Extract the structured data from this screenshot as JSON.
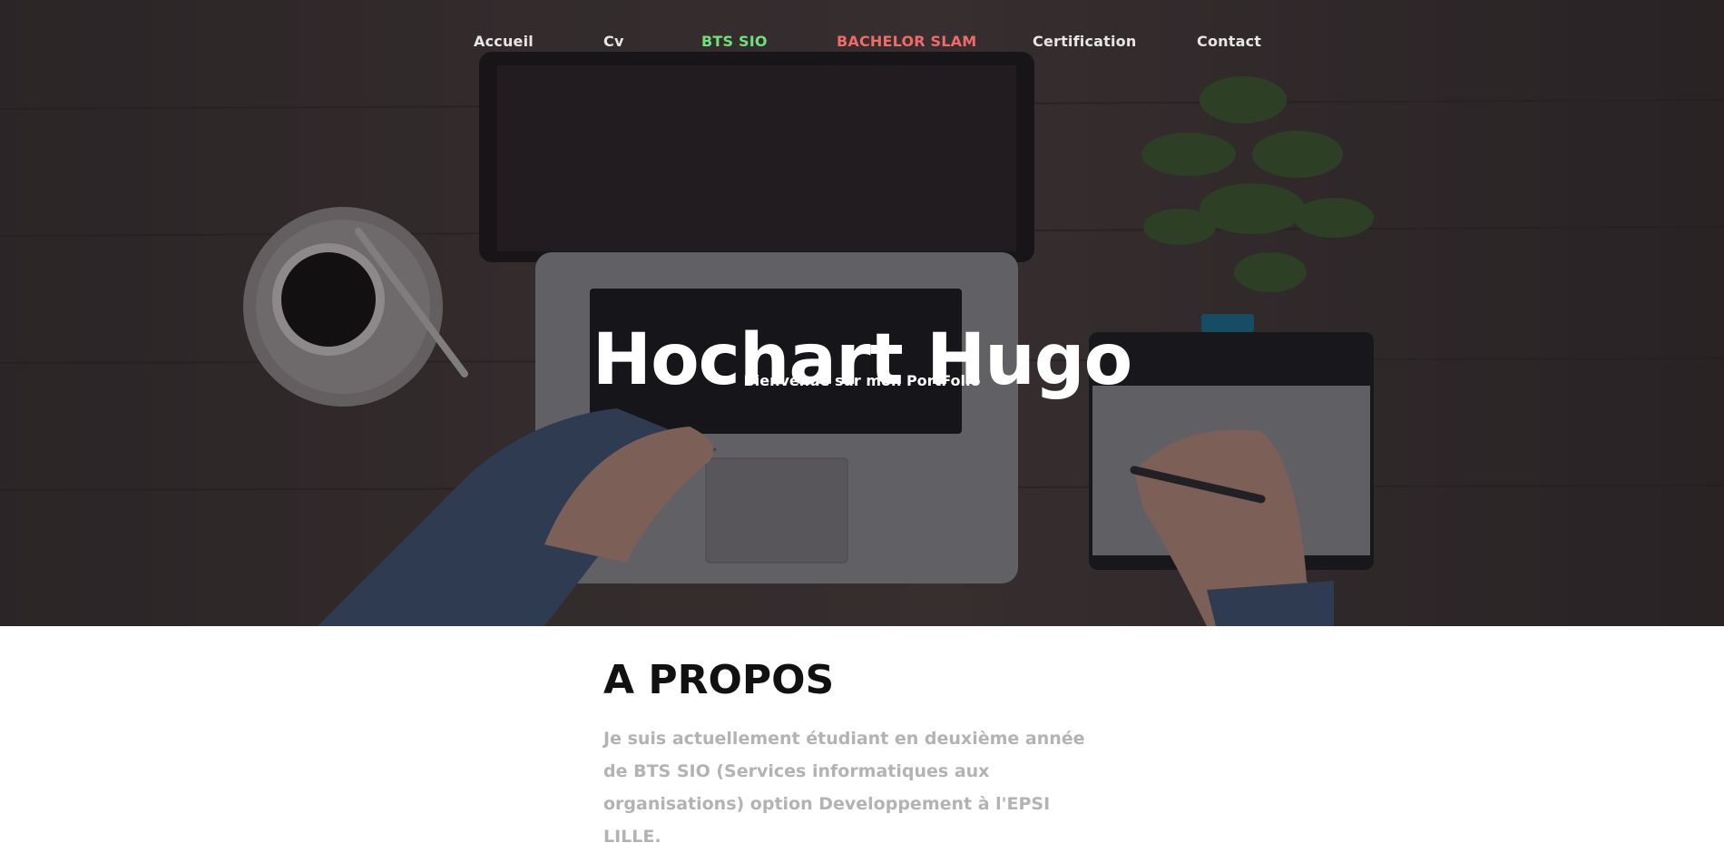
{
  "nav": {
    "items": [
      {
        "label": "Accueil",
        "color": "#e6e6e6"
      },
      {
        "label": "Cv",
        "color": "#e6e6e6"
      },
      {
        "label": "BTS SIO",
        "color": "#6fe07a"
      },
      {
        "label": "BACHELOR SLAM",
        "color": "#f06a6a"
      },
      {
        "label": "Certification",
        "color": "#e6e6e6"
      },
      {
        "label": "Contact",
        "color": "#e6e6e6"
      }
    ]
  },
  "hero": {
    "title": "Hochart Hugo",
    "subtitle": "Bienvenue sur mon PortFolio",
    "background": "desk-photo-laptop-coffee-plant-tablet"
  },
  "about": {
    "heading": "A PROPOS",
    "text": "Je suis actuellement étudiant en deuxième année de BTS SIO (Services informatiques aux organisations) option Developpement à l'EPSI LILLE."
  }
}
